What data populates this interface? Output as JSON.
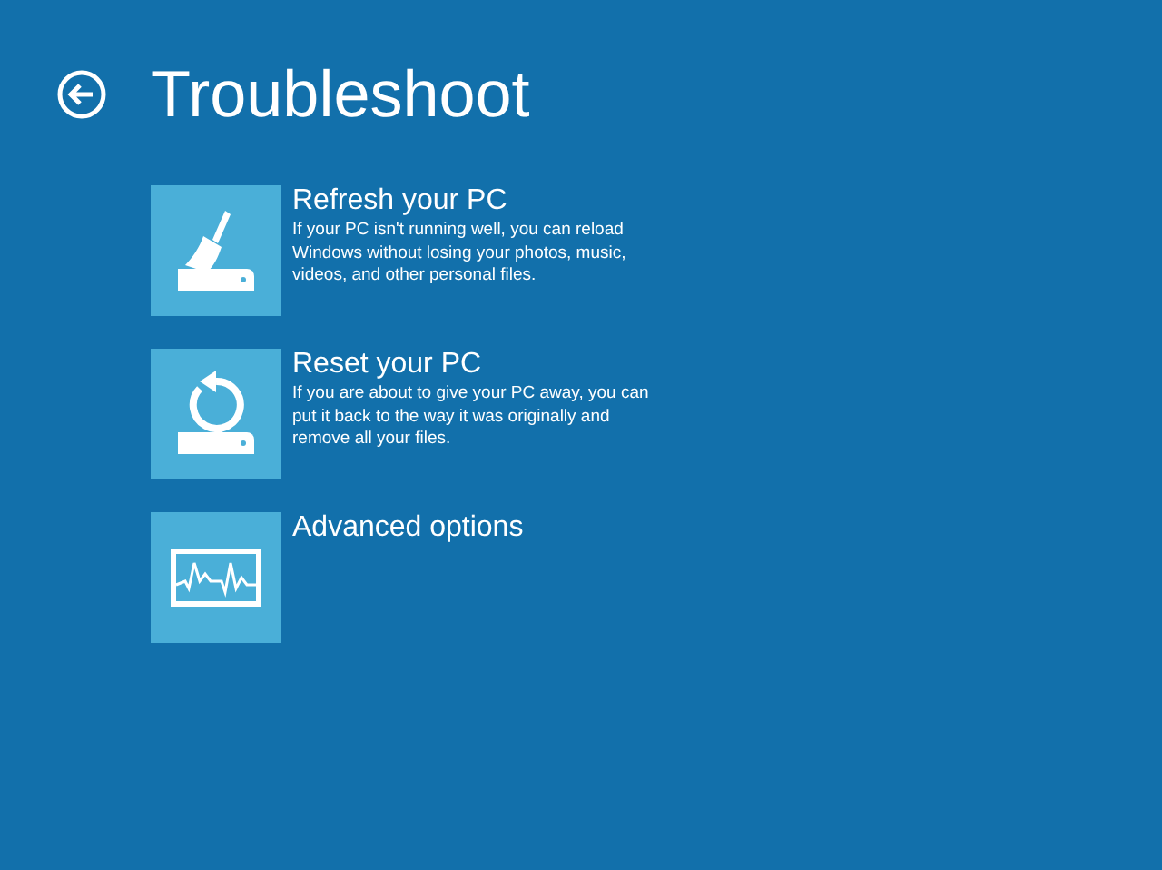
{
  "title": "Troubleshoot",
  "options": [
    {
      "kind": "refresh",
      "title": "Refresh your PC",
      "description": "If your PC isn't running well, you can reload Windows without losing your photos, music, videos, and other personal files."
    },
    {
      "kind": "reset",
      "title": "Reset your PC",
      "description": "If you are about to give your PC away, you can put it back to the way it was originally and remove all your files."
    },
    {
      "kind": "advanced",
      "title": "Advanced options"
    }
  ]
}
